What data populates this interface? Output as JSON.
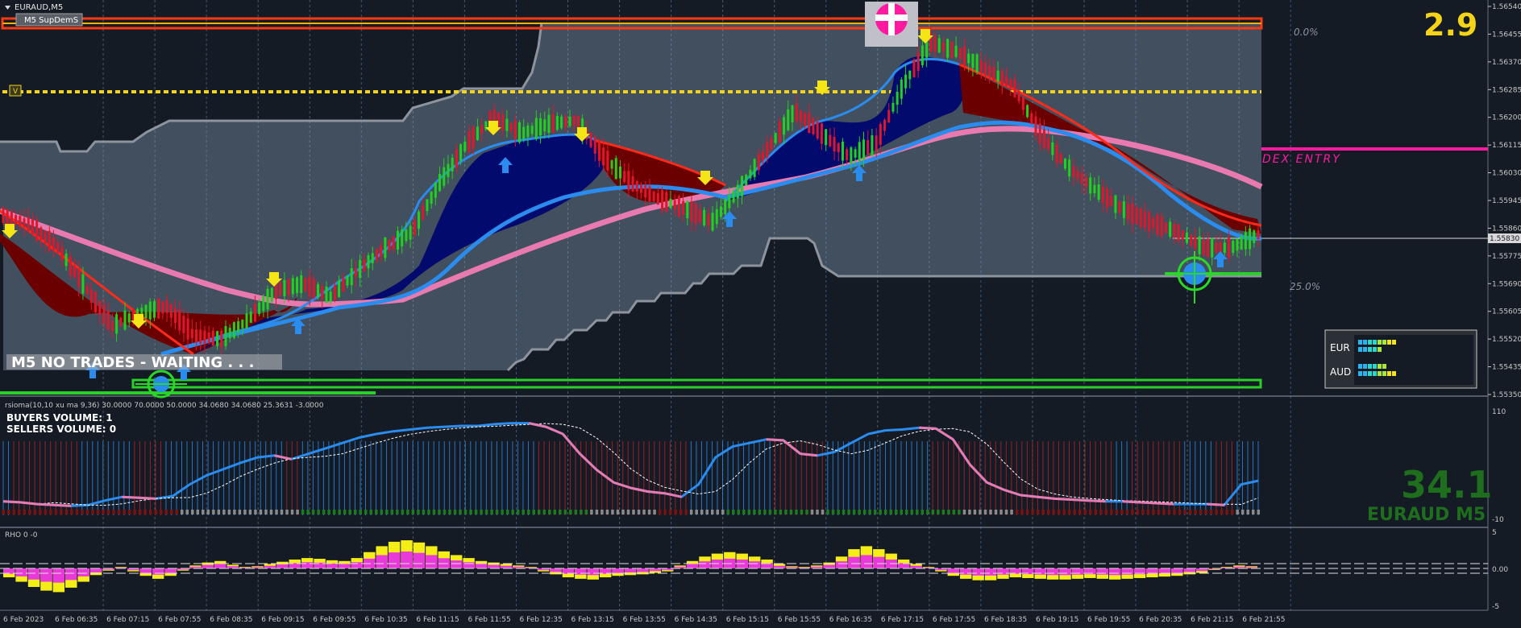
{
  "window": {
    "title": "EURAUD,M5"
  },
  "top_left_label": "M5 SupDemS",
  "v_marker": "V",
  "signal_value": "2.9",
  "status_banner": "M5  NO TRADES - WAITING . . .",
  "current_price": "1.55830",
  "fib_labels": {
    "top": "0.0%",
    "mid": "25.0%"
  },
  "dex_label": "DEX ENTRY",
  "currency_panel": {
    "rows": [
      {
        "label": "EUR",
        "strength": [
          8,
          5
        ]
      },
      {
        "label": "AUD",
        "strength": [
          6,
          8
        ]
      }
    ]
  },
  "rsi_panel": {
    "header": "rsioma(10,10 xu ma 9,36) 30.0000 70.0000 50.0000 34.0680 34.0680 25.3631 -3.0000",
    "buyers_volume": "BUYERS VOLUME: 1",
    "sellers_volume": "SELLERS VOLUME: 0",
    "big_value": "34.1",
    "symbol_tf": "EURAUD M5"
  },
  "rho_panel": {
    "header": "RHO 0 -0"
  },
  "colors": {
    "background": "#141b24",
    "cloud": "#424f5e",
    "bull_fill": "#020a6e",
    "bear_fill": "#6b0000",
    "bull_candle": "#20d21e",
    "bear_candle": "#e0162b",
    "blue_ma": "#2b8cf0",
    "pink_ma": "#e97ab0",
    "yellow_line": "#f5d316",
    "red_line": "#ff2a1a",
    "magenta_line": "#ff1aa0",
    "green_line": "#2ad82a"
  },
  "chart_data": [
    {
      "type": "candlestick",
      "title": "EURAUD,M5",
      "y_axis": {
        "tick_labels": [
          "1.56540",
          "1.56455",
          "1.56370",
          "1.56285",
          "1.56200",
          "1.56115",
          "1.56030",
          "1.55945",
          "1.55860",
          "1.55775",
          "1.55690",
          "1.55605",
          "1.55520",
          "1.55435",
          "1.55350"
        ],
        "range": [
          1.5535,
          1.5654
        ]
      },
      "x_axis": {
        "tick_labels": [
          "6 Feb 2023",
          "6 Feb 06:35",
          "6 Feb 07:15",
          "6 Feb 07:55",
          "6 Feb 08:35",
          "6 Feb 09:15",
          "6 Feb 09:55",
          "6 Feb 10:35",
          "6 Feb 11:15",
          "6 Feb 11:55",
          "6 Feb 12:35",
          "6 Feb 13:15",
          "6 Feb 13:55",
          "6 Feb 14:35",
          "6 Feb 15:15",
          "6 Feb 15:55",
          "6 Feb 16:35",
          "6 Feb 17:15",
          "6 Feb 17:55",
          "6 Feb 18:35",
          "6 Feb 19:15",
          "6 Feb 19:55",
          "6 Feb 20:35",
          "6 Feb 21:15",
          "6 Feb 21:55"
        ]
      },
      "close_path": [
        1.559,
        1.5587,
        1.558,
        1.5568,
        1.5556,
        1.556,
        1.5562,
        1.5553,
        1.5552,
        1.5558,
        1.5567,
        1.5569,
        1.5565,
        1.5573,
        1.558,
        1.5585,
        1.56,
        1.5612,
        1.562,
        1.5615,
        1.5618,
        1.5619,
        1.5608,
        1.56,
        1.5595,
        1.5592,
        1.5588,
        1.5598,
        1.561,
        1.5622,
        1.5615,
        1.5608,
        1.5612,
        1.563,
        1.5643,
        1.564,
        1.5635,
        1.563,
        1.5615,
        1.5605,
        1.5598,
        1.5592,
        1.5588,
        1.5585,
        1.558,
        1.558,
        1.5584
      ],
      "horizontal_levels": {
        "red_top": 1.5652,
        "yellow_dotted": 1.5629,
        "magenta": 1.5612,
        "current": 1.5583,
        "green_bottom": 1.5538
      }
    },
    {
      "type": "line",
      "title": "rsioma",
      "y_axis": {
        "tick_labels": [
          "110",
          "-10"
        ],
        "range": [
          -10,
          110
        ]
      },
      "rsi_line": [
        9,
        8,
        6,
        5,
        4,
        5,
        10,
        14,
        13,
        12,
        15,
        28,
        38,
        45,
        52,
        58,
        60,
        56,
        62,
        68,
        74,
        80,
        84,
        87,
        89,
        91,
        92,
        93,
        93,
        95,
        96,
        96,
        92,
        84,
        62,
        44,
        30,
        24,
        20,
        18,
        14,
        28,
        58,
        70,
        74,
        78,
        77,
        62,
        60,
        64,
        74,
        84,
        88,
        89,
        91,
        90,
        78,
        50,
        30,
        22,
        16,
        14,
        12,
        11,
        10,
        9,
        9,
        8,
        7,
        6,
        6,
        6,
        5,
        28,
        32
      ]
    },
    {
      "type": "bar",
      "title": "RHO",
      "y_axis": {
        "tick_labels": [
          "5",
          "0.00",
          "-5"
        ],
        "range": [
          -5,
          5
        ]
      },
      "values": [
        -1.2,
        -1.8,
        -2.5,
        -3.0,
        -3.2,
        -2.6,
        -1.8,
        -0.9,
        -0.3,
        0.2,
        -0.4,
        -1.0,
        -1.4,
        -1.0,
        -0.3,
        0.4,
        0.8,
        1.0,
        0.5,
        0.2,
        0.3,
        0.6,
        0.9,
        1.2,
        1.4,
        1.3,
        1.1,
        1.0,
        1.4,
        2.2,
        3.0,
        3.6,
        3.8,
        3.5,
        3.0,
        2.3,
        1.8,
        1.4,
        1.0,
        0.8,
        0.6,
        0.4,
        0.2,
        -0.4,
        -0.8,
        -1.2,
        -1.4,
        -1.5,
        -1.2,
        -1.0,
        -0.9,
        -0.8,
        -0.6,
        -0.4,
        0.4,
        1.0,
        1.6,
        2.0,
        2.2,
        2.0,
        1.6,
        1.2,
        0.6,
        0.3,
        0.2,
        0.4,
        0.8,
        1.6,
        2.6,
        3.0,
        2.6,
        2.0,
        1.2,
        0.6,
        0.2,
        -0.4,
        -1.0,
        -1.4,
        -1.6,
        -1.6,
        -1.4,
        -1.2,
        -1.3,
        -1.4,
        -1.5,
        -1.5,
        -1.4,
        -1.3,
        -1.4,
        -1.5,
        -1.4,
        -1.3,
        -1.2,
        -1.1,
        -1.0,
        -0.8,
        -0.6,
        -0.2,
        0.2,
        0.4,
        0.3
      ]
    }
  ]
}
